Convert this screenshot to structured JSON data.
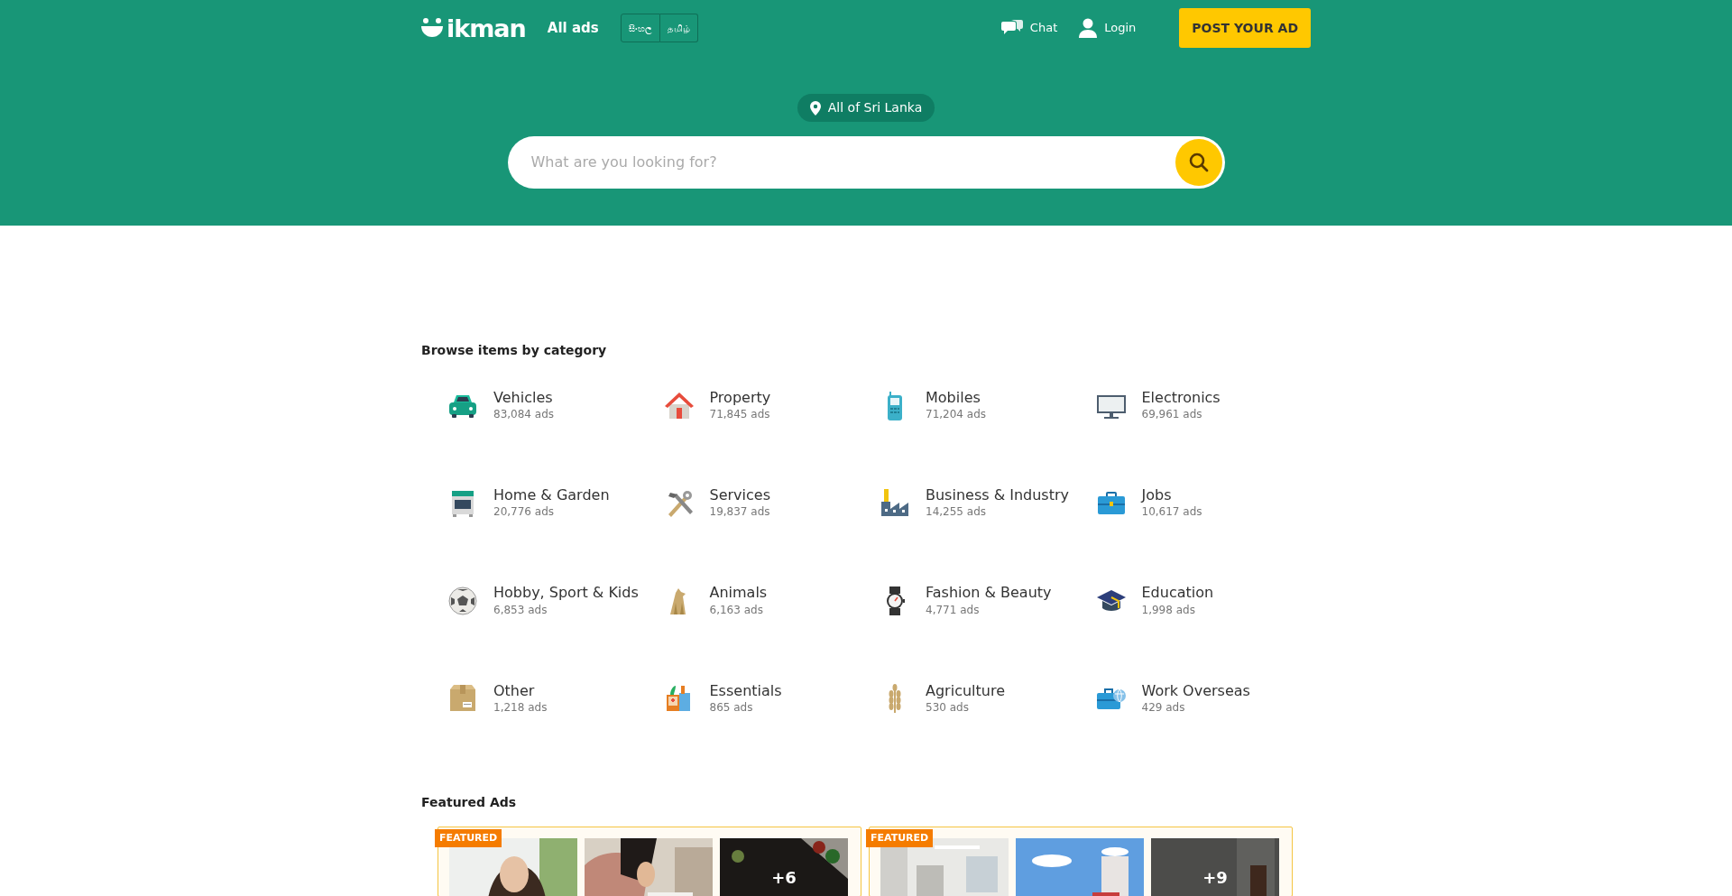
{
  "header": {
    "logo": "ikman",
    "nav_link": "All ads",
    "languages": [
      {
        "label": "සිංහල"
      },
      {
        "label": "தமிழ்"
      }
    ],
    "chat": "Chat",
    "login": "Login",
    "post_button": "POST YOUR AD"
  },
  "search": {
    "location": "All of Sri Lanka",
    "placeholder": "What are you looking for?"
  },
  "categories": {
    "title": "Browse items by category",
    "items": [
      {
        "name": "Vehicles",
        "count": "83,084 ads"
      },
      {
        "name": "Property",
        "count": "71,845 ads"
      },
      {
        "name": "Mobiles",
        "count": "71,204 ads"
      },
      {
        "name": "Electronics",
        "count": "69,961 ads"
      },
      {
        "name": "Home & Garden",
        "count": "20,776 ads"
      },
      {
        "name": "Services",
        "count": "19,837 ads"
      },
      {
        "name": "Business & Industry",
        "count": "14,255 ads"
      },
      {
        "name": "Jobs",
        "count": "10,617 ads"
      },
      {
        "name": "Hobby, Sport & Kids",
        "count": "6,853 ads"
      },
      {
        "name": "Animals",
        "count": "6,163 ads"
      },
      {
        "name": "Fashion & Beauty",
        "count": "4,771 ads"
      },
      {
        "name": "Education",
        "count": "1,998 ads"
      },
      {
        "name": "Other",
        "count": "1,218 ads"
      },
      {
        "name": "Essentials",
        "count": "865 ads"
      },
      {
        "name": "Agriculture",
        "count": "530 ads"
      },
      {
        "name": "Work Overseas",
        "count": "429 ads"
      }
    ]
  },
  "featured": {
    "title": "Featured Ads",
    "ads": [
      {
        "badge": "FEATURED",
        "more": "+6"
      },
      {
        "badge": "FEATURED",
        "more": "+9"
      }
    ]
  }
}
